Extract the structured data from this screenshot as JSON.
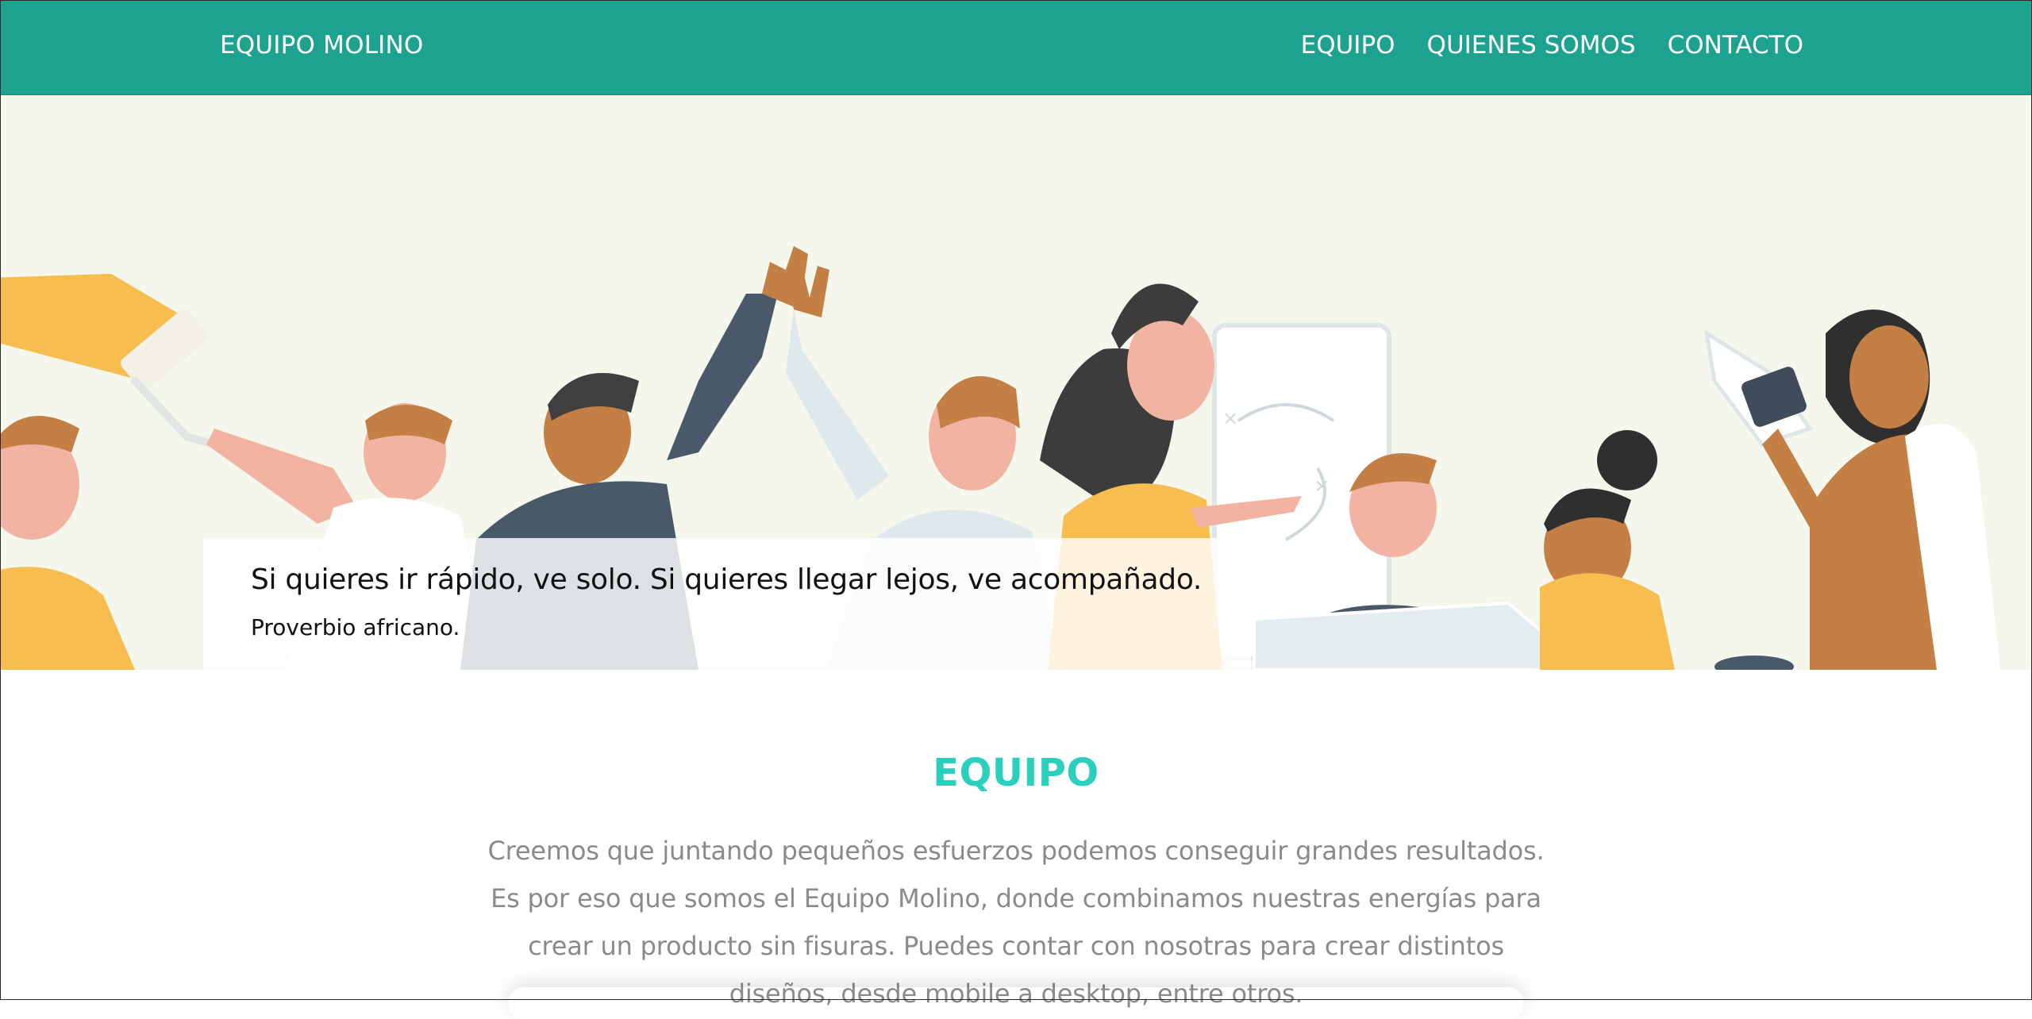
{
  "navbar": {
    "brand": "EQUIPO MOLINO",
    "links": [
      {
        "label": "EQUIPO"
      },
      {
        "label": "QUIENES SOMOS"
      },
      {
        "label": "CONTACTO"
      }
    ],
    "background_color": "#1ea290"
  },
  "hero": {
    "quote": "Si quieres ir rápido, ve solo. Si quieres llegar lejos, ve acompañado.",
    "author": "Proverbio africano.",
    "background_color": "#f5f6ec",
    "illustration": "team-collaboration-illustration"
  },
  "team_section": {
    "title": "EQUIPO",
    "title_color": "#2bcfbd",
    "description": "Creemos que juntando pequeños esfuerzos podemos conseguir grandes resultados. Es por eso que somos el Equipo Molino, donde combinamos nuestras energías para crear un producto sin fisuras. Puedes contar con nosotras para crear distintos diseños, desde mobile a desktop, entre otros."
  }
}
